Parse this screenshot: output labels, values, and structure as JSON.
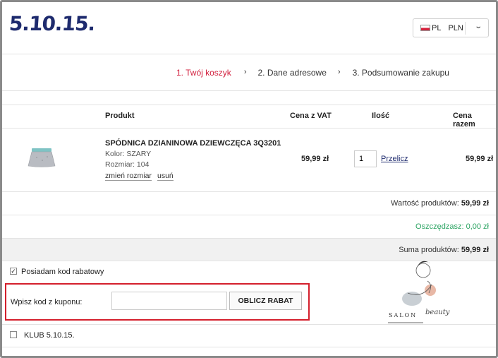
{
  "header": {
    "logo": "5.10.15.",
    "lang": "PL",
    "currency": "PLN"
  },
  "steps": [
    {
      "label": "1. Twój koszyk",
      "active": true
    },
    {
      "label": "2. Dane adresowe",
      "active": false
    },
    {
      "label": "3. Podsumowanie zakupu",
      "active": false
    }
  ],
  "step_separator": "›",
  "table": {
    "headers": {
      "product": "Produkt",
      "price": "Cena z VAT",
      "qty": "Ilość",
      "total": "Cena razem"
    },
    "item": {
      "name": "SPÓDNICA DZIANINOWA DZIEWCZĘCA 3Q3201",
      "color": "Kolor: SZARY",
      "size": "Rozmiar: 104",
      "change_size": "zmień rozmiar",
      "remove": "usuń",
      "price": "59,99 zł",
      "qty": "1",
      "recalc": "Przelicz",
      "total": "59,99 zł"
    }
  },
  "summary": {
    "products_label": "Wartość produktów:",
    "products_value": "59,99 zł",
    "saved_label": "Oszczędzasz:",
    "saved_value": "0,00 zł",
    "sum_label": "Suma produktów:",
    "sum_value": "59,99 zł"
  },
  "coupon": {
    "checkbox_label": "Posiadam kod rabatowy",
    "checked": true,
    "input_label": "Wpisz kod z kuponu:",
    "input_value": "",
    "button": "OBLICZ RABAT"
  },
  "club": {
    "label": "KLUB 5.10.15.",
    "checked": false
  },
  "watermark": {
    "text": "SALON",
    "script": "beauty"
  },
  "colors": {
    "accent": "#d2203e",
    "brand": "#1e2b6e",
    "green": "#2aa361",
    "highlight_box": "#d41f2c"
  }
}
